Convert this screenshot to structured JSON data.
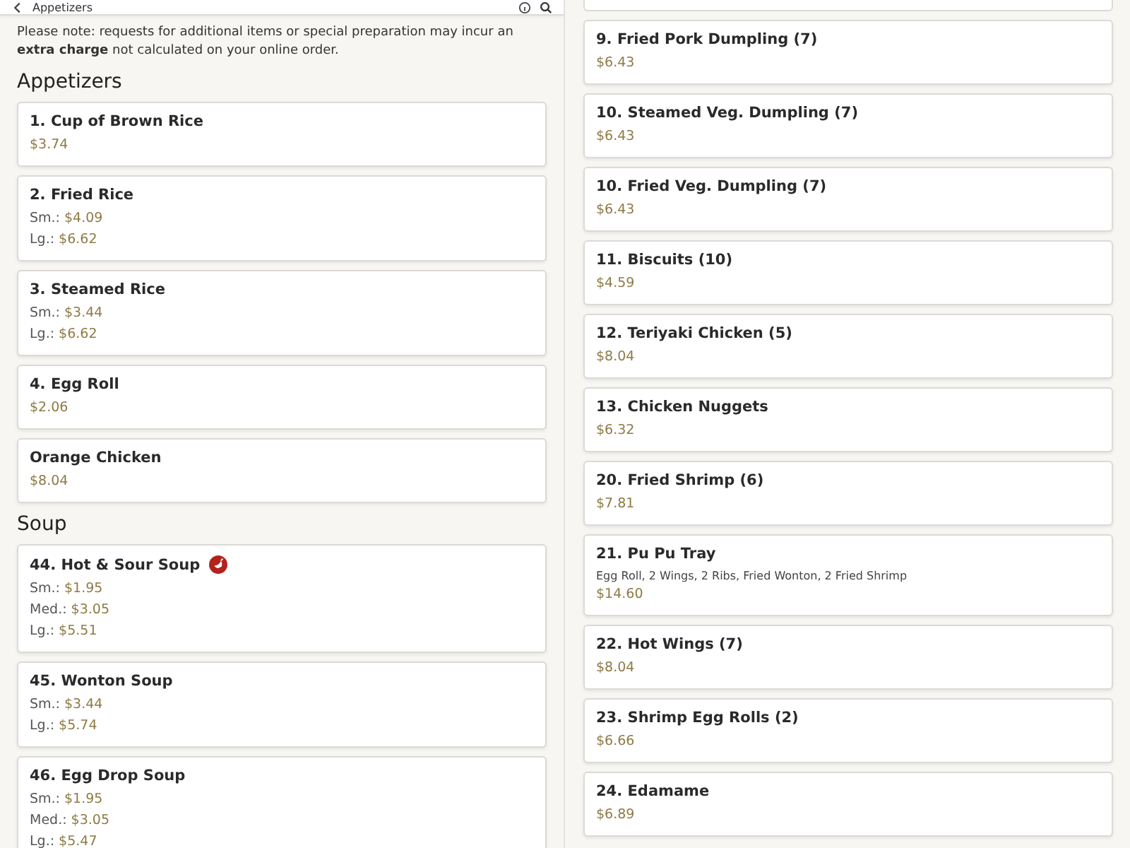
{
  "header": {
    "title": "Appetizers"
  },
  "left": {
    "notice": "Please note: requests for additional items or special preparation may incur an **extra charge** not calculated on your online order.",
    "sections": [
      {
        "title": "Appetizers",
        "items": [
          {
            "name": "1. Cup of Brown Rice",
            "spicy": false,
            "prices": [
              {
                "price": "$3.74"
              }
            ]
          },
          {
            "name": "2. Fried Rice",
            "spicy": false,
            "prices": [
              {
                "size": "Sm.:",
                "price": "$4.09"
              },
              {
                "size": "Lg.:",
                "price": "$6.62"
              }
            ]
          },
          {
            "name": "3. Steamed Rice",
            "spicy": false,
            "prices": [
              {
                "size": "Sm.:",
                "price": "$3.44"
              },
              {
                "size": "Lg.:",
                "price": "$6.62"
              }
            ]
          },
          {
            "name": "4. Egg Roll",
            "spicy": false,
            "prices": [
              {
                "price": "$2.06"
              }
            ]
          },
          {
            "name": "Orange Chicken",
            "spicy": false,
            "prices": [
              {
                "price": "$8.04"
              }
            ]
          }
        ]
      },
      {
        "title": "Soup",
        "items": [
          {
            "name": "44. Hot & Sour Soup",
            "spicy": true,
            "prices": [
              {
                "size": "Sm.:",
                "price": "$1.95"
              },
              {
                "size": "Med.:",
                "price": "$3.05"
              },
              {
                "size": "Lg.:",
                "price": "$5.51"
              }
            ]
          },
          {
            "name": "45. Wonton Soup",
            "spicy": false,
            "prices": [
              {
                "size": "Sm.:",
                "price": "$3.44"
              },
              {
                "size": "Lg.:",
                "price": "$5.74"
              }
            ]
          },
          {
            "name": "46. Egg Drop Soup",
            "spicy": false,
            "prices": [
              {
                "size": "Sm.:",
                "price": "$1.95"
              },
              {
                "size": "Med.:",
                "price": "$3.05"
              },
              {
                "size": "Lg.:",
                "price": "$5.47"
              }
            ]
          }
        ]
      }
    ]
  },
  "right": {
    "items": [
      {
        "name": "9. Fried Pork Dumpling (7)",
        "spicy": false,
        "prices": [
          {
            "price": "$6.43"
          }
        ]
      },
      {
        "name": "10. Steamed Veg. Dumpling (7)",
        "spicy": false,
        "prices": [
          {
            "price": "$6.43"
          }
        ]
      },
      {
        "name": "10. Fried Veg. Dumpling (7)",
        "spicy": false,
        "prices": [
          {
            "price": "$6.43"
          }
        ]
      },
      {
        "name": "11. Biscuits (10)",
        "spicy": false,
        "prices": [
          {
            "price": "$4.59"
          }
        ]
      },
      {
        "name": "12. Teriyaki Chicken (5)",
        "spicy": false,
        "prices": [
          {
            "price": "$8.04"
          }
        ]
      },
      {
        "name": "13. Chicken Nuggets",
        "spicy": false,
        "prices": [
          {
            "price": "$6.32"
          }
        ]
      },
      {
        "name": "20. Fried Shrimp (6)",
        "spicy": false,
        "prices": [
          {
            "price": "$7.81"
          }
        ]
      },
      {
        "name": "21. Pu Pu Tray",
        "spicy": false,
        "description": "Egg Roll, 2 Wings, 2 Ribs, Fried Wonton, 2 Fried Shrimp",
        "prices": [
          {
            "price": "$14.60"
          }
        ]
      },
      {
        "name": "22. Hot Wings (7)",
        "spicy": false,
        "prices": [
          {
            "price": "$8.04"
          }
        ]
      },
      {
        "name": "23. Shrimp Egg Rolls (2)",
        "spicy": false,
        "prices": [
          {
            "price": "$6.66"
          }
        ]
      },
      {
        "name": "24. Edamame",
        "spicy": false,
        "prices": [
          {
            "price": "$6.89"
          }
        ]
      }
    ]
  }
}
